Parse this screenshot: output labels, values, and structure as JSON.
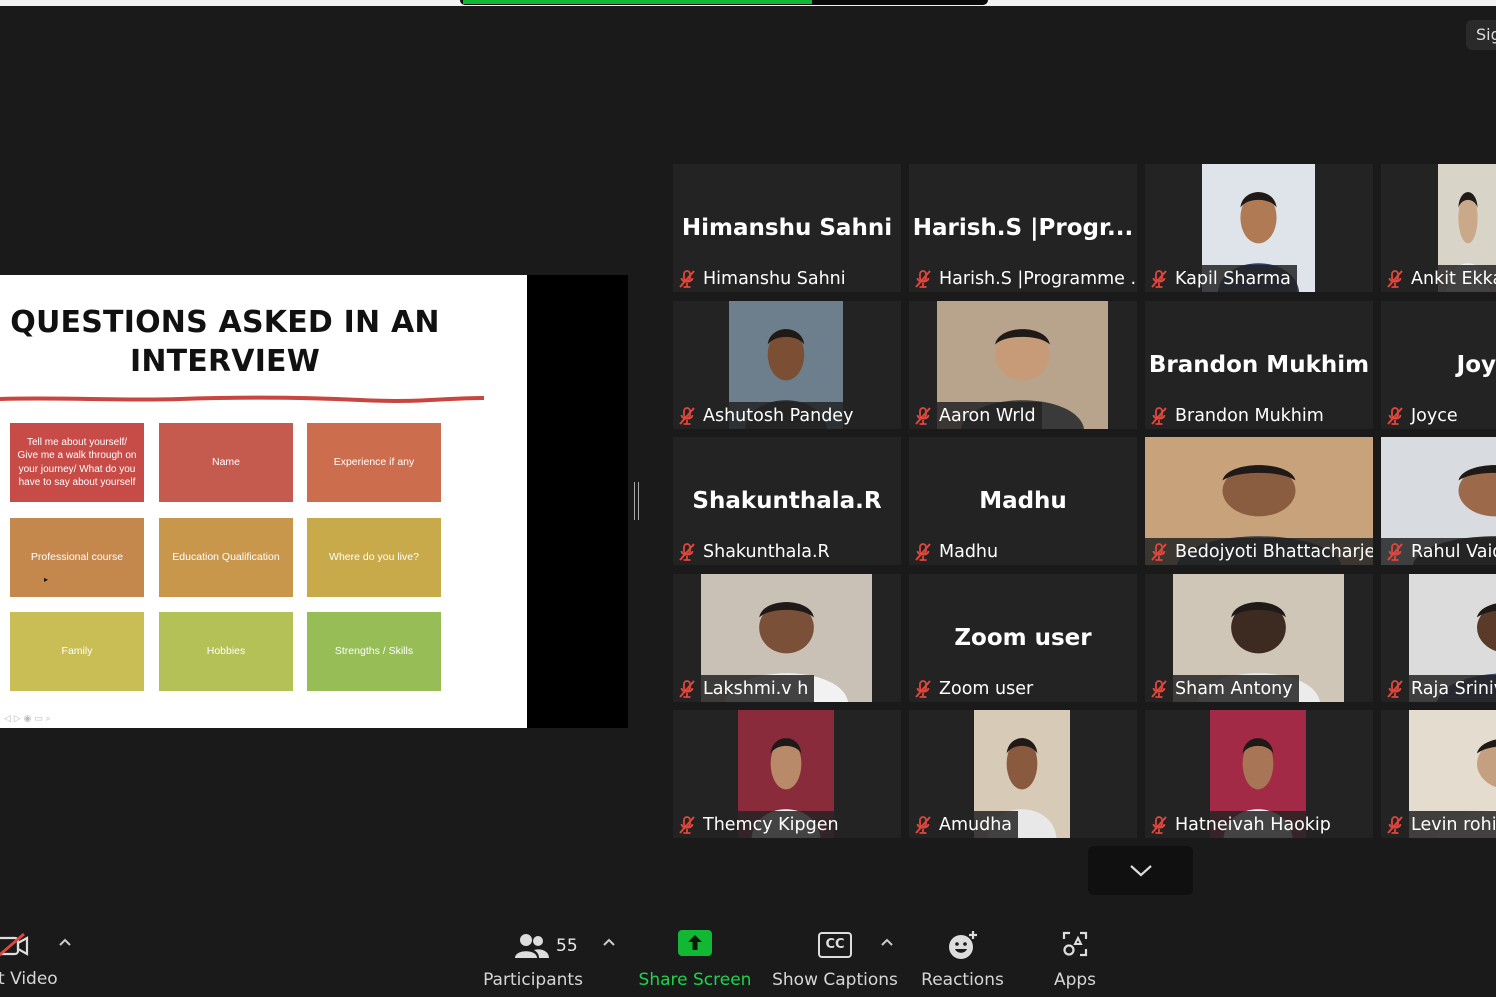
{
  "top": {
    "sign_label": "Sig",
    "share_progress": 0.66
  },
  "slide": {
    "title_line1": "QUESTIONS ASKED IN AN",
    "title_line2": "INTERVIEW",
    "boxes": [
      {
        "text": "Tell me about yourself/ Give me a walk through on your journey/ What do you have to say about yourself",
        "color": "#c74b47"
      },
      {
        "text": "Name",
        "color": "#c55b4f"
      },
      {
        "text": "Experience if any",
        "color": "#cc6e4e"
      },
      {
        "text": "Professional course",
        "color": "#c4874c"
      },
      {
        "text": "Education Qualification",
        "color": "#c9974c"
      },
      {
        "text": "Where do you live?",
        "color": "#c8aa4a"
      },
      {
        "text": "Family",
        "color": "#c9be55"
      },
      {
        "text": "Hobbies",
        "color": "#b4c157"
      },
      {
        "text": "Strengths / Skills",
        "color": "#97bd57"
      }
    ]
  },
  "tiles": [
    {
      "display": "Himanshu Sahni",
      "name": "Himanshu Sahni"
    },
    {
      "display": "Harish.S  |Progr...",
      "name": "Harish.S |Programme ..."
    },
    {
      "display": "",
      "name": "Kapil Sharma"
    },
    {
      "display": "",
      "name": "Ankit Ekka"
    },
    {
      "display": "",
      "name": "Ashutosh Pandey"
    },
    {
      "display": "",
      "name": "Aaron Wrld"
    },
    {
      "display": "Brandon Mukhim",
      "name": "Brandon Mukhim"
    },
    {
      "display": "Joy",
      "name": "Joyce"
    },
    {
      "display": "Shakunthala.R",
      "name": "Shakunthala.R"
    },
    {
      "display": "Madhu",
      "name": "Madhu"
    },
    {
      "display": "",
      "name": "Bedojyoti Bhattacharjee"
    },
    {
      "display": "",
      "name": "Rahul Vaid"
    },
    {
      "display": "",
      "name": "Lakshmi.v h"
    },
    {
      "display": "Zoom user",
      "name": "Zoom user"
    },
    {
      "display": "",
      "name": "Sham Antony"
    },
    {
      "display": "",
      "name": "Raja Sriniv"
    },
    {
      "display": "",
      "name": "Themcy Kipgen"
    },
    {
      "display": "",
      "name": "Amudha"
    },
    {
      "display": "",
      "name": "Hatneivah Haokip"
    },
    {
      "display": "",
      "name": "Levin rohit"
    }
  ],
  "toolbar": {
    "video_label": "t Video",
    "participants_count": "55",
    "participants_label": "Participants",
    "share_label": "Share Screen",
    "captions_label": "Show Captions",
    "cc_text": "CC",
    "reactions_label": "Reactions",
    "apps_label": "Apps"
  },
  "icons": {
    "mic": "mic-muted-icon",
    "video": "video-off-icon",
    "participants": "participants-icon",
    "share": "share-screen-icon",
    "captions": "captions-icon",
    "reactions": "reactions-icon",
    "apps": "apps-icon",
    "scroll": "chevron-down-icon"
  },
  "colors": {
    "share_green": "#12b834",
    "active_speaker": "#d8e76b",
    "muted_red": "#e0463c"
  }
}
